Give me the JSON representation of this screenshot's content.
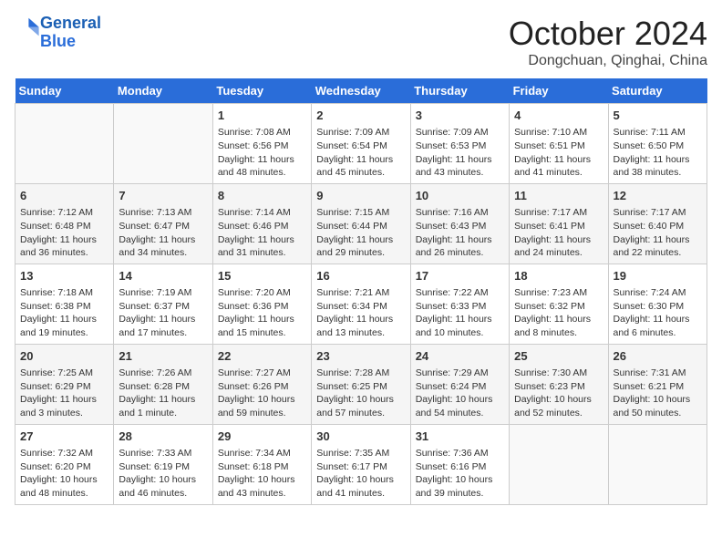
{
  "header": {
    "logo_line1": "General",
    "logo_line2": "Blue",
    "month_title": "October 2024",
    "location": "Dongchuan, Qinghai, China"
  },
  "days_of_week": [
    "Sunday",
    "Monday",
    "Tuesday",
    "Wednesday",
    "Thursday",
    "Friday",
    "Saturday"
  ],
  "weeks": [
    [
      {
        "day": "",
        "detail": ""
      },
      {
        "day": "",
        "detail": ""
      },
      {
        "day": "1",
        "detail": "Sunrise: 7:08 AM\nSunset: 6:56 PM\nDaylight: 11 hours and 48 minutes."
      },
      {
        "day": "2",
        "detail": "Sunrise: 7:09 AM\nSunset: 6:54 PM\nDaylight: 11 hours and 45 minutes."
      },
      {
        "day": "3",
        "detail": "Sunrise: 7:09 AM\nSunset: 6:53 PM\nDaylight: 11 hours and 43 minutes."
      },
      {
        "day": "4",
        "detail": "Sunrise: 7:10 AM\nSunset: 6:51 PM\nDaylight: 11 hours and 41 minutes."
      },
      {
        "day": "5",
        "detail": "Sunrise: 7:11 AM\nSunset: 6:50 PM\nDaylight: 11 hours and 38 minutes."
      }
    ],
    [
      {
        "day": "6",
        "detail": "Sunrise: 7:12 AM\nSunset: 6:48 PM\nDaylight: 11 hours and 36 minutes."
      },
      {
        "day": "7",
        "detail": "Sunrise: 7:13 AM\nSunset: 6:47 PM\nDaylight: 11 hours and 34 minutes."
      },
      {
        "day": "8",
        "detail": "Sunrise: 7:14 AM\nSunset: 6:46 PM\nDaylight: 11 hours and 31 minutes."
      },
      {
        "day": "9",
        "detail": "Sunrise: 7:15 AM\nSunset: 6:44 PM\nDaylight: 11 hours and 29 minutes."
      },
      {
        "day": "10",
        "detail": "Sunrise: 7:16 AM\nSunset: 6:43 PM\nDaylight: 11 hours and 26 minutes."
      },
      {
        "day": "11",
        "detail": "Sunrise: 7:17 AM\nSunset: 6:41 PM\nDaylight: 11 hours and 24 minutes."
      },
      {
        "day": "12",
        "detail": "Sunrise: 7:17 AM\nSunset: 6:40 PM\nDaylight: 11 hours and 22 minutes."
      }
    ],
    [
      {
        "day": "13",
        "detail": "Sunrise: 7:18 AM\nSunset: 6:38 PM\nDaylight: 11 hours and 19 minutes."
      },
      {
        "day": "14",
        "detail": "Sunrise: 7:19 AM\nSunset: 6:37 PM\nDaylight: 11 hours and 17 minutes."
      },
      {
        "day": "15",
        "detail": "Sunrise: 7:20 AM\nSunset: 6:36 PM\nDaylight: 11 hours and 15 minutes."
      },
      {
        "day": "16",
        "detail": "Sunrise: 7:21 AM\nSunset: 6:34 PM\nDaylight: 11 hours and 13 minutes."
      },
      {
        "day": "17",
        "detail": "Sunrise: 7:22 AM\nSunset: 6:33 PM\nDaylight: 11 hours and 10 minutes."
      },
      {
        "day": "18",
        "detail": "Sunrise: 7:23 AM\nSunset: 6:32 PM\nDaylight: 11 hours and 8 minutes."
      },
      {
        "day": "19",
        "detail": "Sunrise: 7:24 AM\nSunset: 6:30 PM\nDaylight: 11 hours and 6 minutes."
      }
    ],
    [
      {
        "day": "20",
        "detail": "Sunrise: 7:25 AM\nSunset: 6:29 PM\nDaylight: 11 hours and 3 minutes."
      },
      {
        "day": "21",
        "detail": "Sunrise: 7:26 AM\nSunset: 6:28 PM\nDaylight: 11 hours and 1 minute."
      },
      {
        "day": "22",
        "detail": "Sunrise: 7:27 AM\nSunset: 6:26 PM\nDaylight: 10 hours and 59 minutes."
      },
      {
        "day": "23",
        "detail": "Sunrise: 7:28 AM\nSunset: 6:25 PM\nDaylight: 10 hours and 57 minutes."
      },
      {
        "day": "24",
        "detail": "Sunrise: 7:29 AM\nSunset: 6:24 PM\nDaylight: 10 hours and 54 minutes."
      },
      {
        "day": "25",
        "detail": "Sunrise: 7:30 AM\nSunset: 6:23 PM\nDaylight: 10 hours and 52 minutes."
      },
      {
        "day": "26",
        "detail": "Sunrise: 7:31 AM\nSunset: 6:21 PM\nDaylight: 10 hours and 50 minutes."
      }
    ],
    [
      {
        "day": "27",
        "detail": "Sunrise: 7:32 AM\nSunset: 6:20 PM\nDaylight: 10 hours and 48 minutes."
      },
      {
        "day": "28",
        "detail": "Sunrise: 7:33 AM\nSunset: 6:19 PM\nDaylight: 10 hours and 46 minutes."
      },
      {
        "day": "29",
        "detail": "Sunrise: 7:34 AM\nSunset: 6:18 PM\nDaylight: 10 hours and 43 minutes."
      },
      {
        "day": "30",
        "detail": "Sunrise: 7:35 AM\nSunset: 6:17 PM\nDaylight: 10 hours and 41 minutes."
      },
      {
        "day": "31",
        "detail": "Sunrise: 7:36 AM\nSunset: 6:16 PM\nDaylight: 10 hours and 39 minutes."
      },
      {
        "day": "",
        "detail": ""
      },
      {
        "day": "",
        "detail": ""
      }
    ]
  ]
}
